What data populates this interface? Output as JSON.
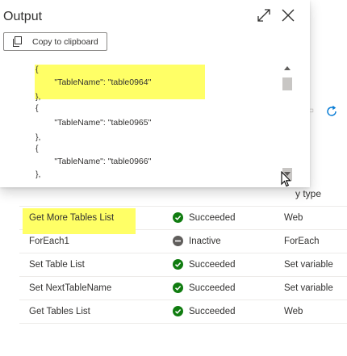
{
  "dialog": {
    "title": "Output",
    "copy_button": "Copy to clipboard",
    "icons": {
      "expand": "expand-icon",
      "close": "close-icon",
      "copy": "copy-icon"
    },
    "code_lines": [
      "{",
      "        \"TableName\": \"table0964\"",
      "},",
      "{",
      "        \"TableName\": \"table0965\"",
      "},",
      "{",
      "        \"TableName\": \"table0966\"",
      "},"
    ],
    "highlight_color": "#ffff66"
  },
  "table": {
    "partial_header": "y type",
    "rows": [
      {
        "name": "Get More Tables List",
        "status": "Succeeded",
        "status_kind": "succeeded",
        "type": "Web",
        "highlighted": true
      },
      {
        "name": "ForEach1",
        "status": "Inactive",
        "status_kind": "inactive",
        "type": "ForEach",
        "highlighted": false
      },
      {
        "name": "Set Table List",
        "status": "Succeeded",
        "status_kind": "succeeded",
        "type": "Set variable",
        "highlighted": false
      },
      {
        "name": "Set NextTableName",
        "status": "Succeeded",
        "status_kind": "succeeded",
        "type": "Set variable",
        "highlighted": false
      },
      {
        "name": "Get Tables List",
        "status": "Succeeded",
        "status_kind": "succeeded",
        "type": "Web",
        "highlighted": false
      }
    ],
    "colors": {
      "succeeded": "#107c10",
      "inactive": "#605e5c"
    },
    "icons": {
      "refresh": "refresh-icon"
    }
  }
}
